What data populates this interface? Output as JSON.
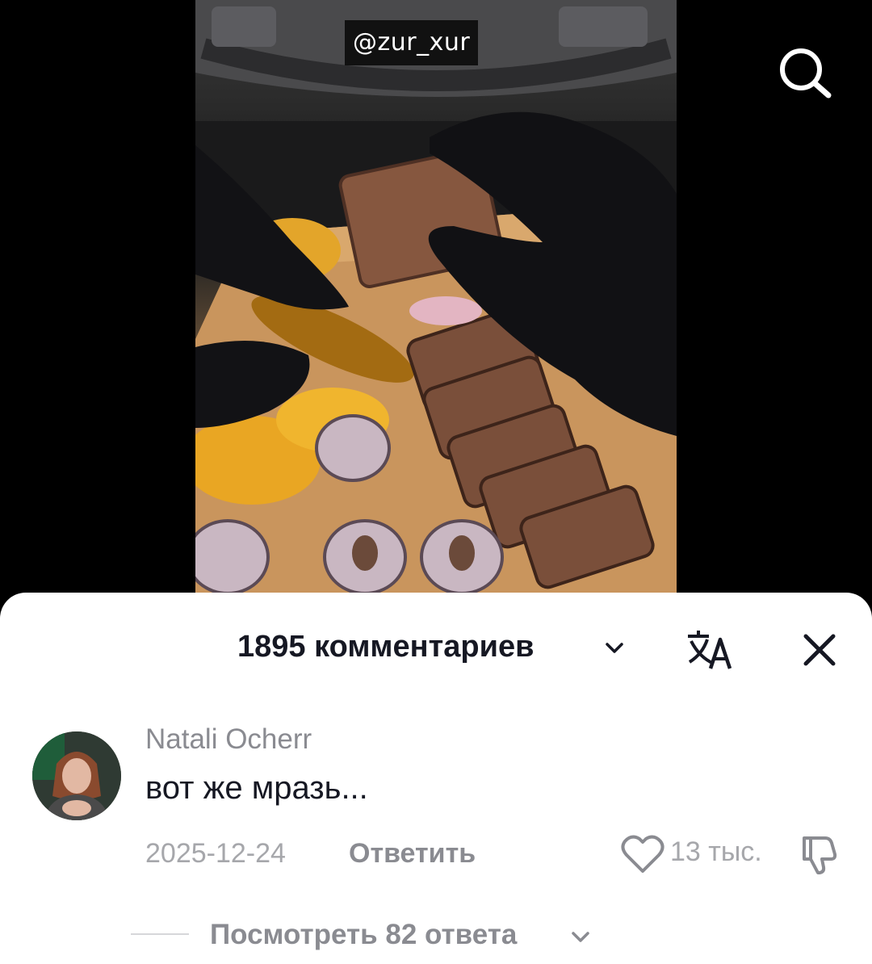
{
  "video": {
    "watermark": "@zur_xur",
    "search_icon": "search-icon"
  },
  "comments_sheet": {
    "title": "1895 комментариев",
    "translate_icon": "translate-icon",
    "close_icon": "close-icon"
  },
  "comment": {
    "username": "Natali Ocherr",
    "text": "вот же мразь...",
    "date": "2025-12-24",
    "reply_label": "Ответить",
    "like_count": "13 тыс.",
    "like_icon": "heart-icon",
    "dislike_icon": "thumbs-down-icon"
  },
  "replies": {
    "label": "Посмотреть 82 ответа"
  }
}
